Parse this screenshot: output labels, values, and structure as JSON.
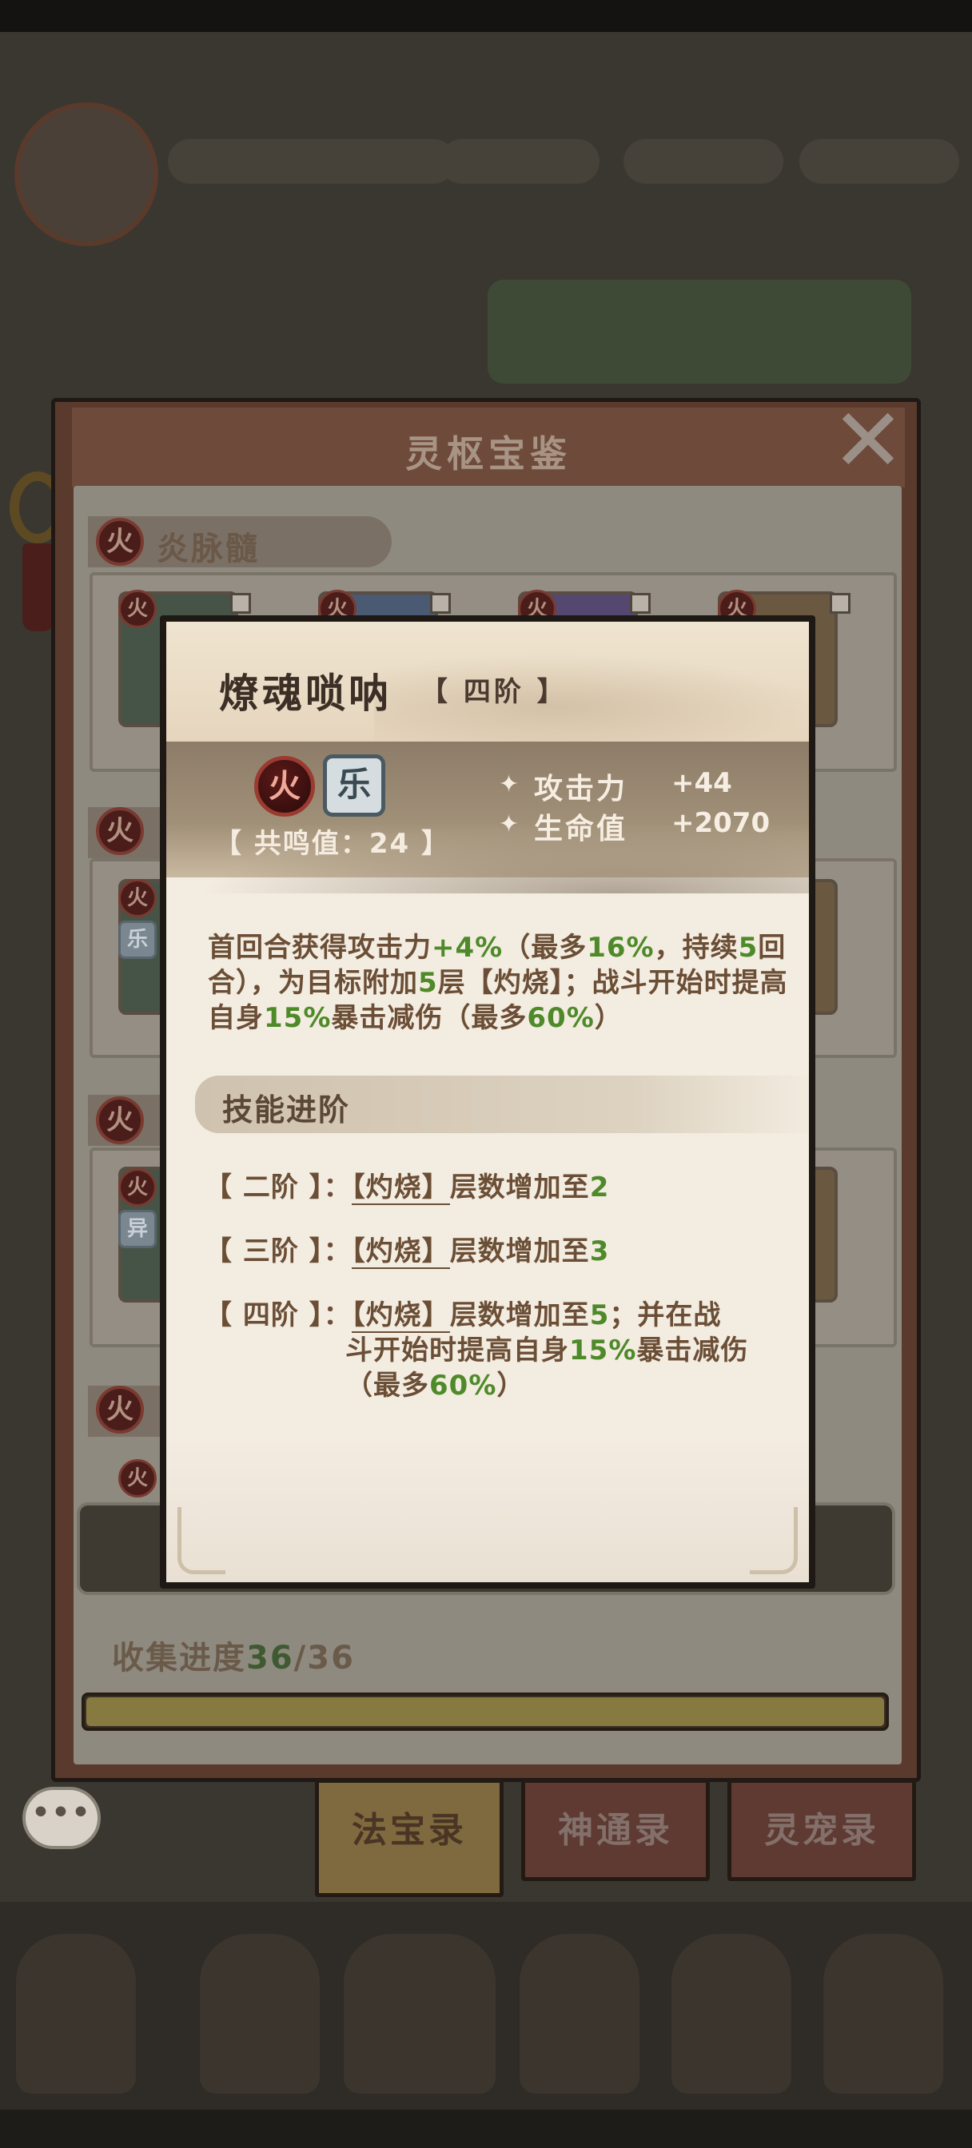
{
  "book": {
    "title": "灵枢宝鉴",
    "close_symbol": "✕",
    "section1": {
      "element": "火",
      "name": "炎脉髓"
    },
    "section_elem": "火",
    "card_tags": [
      "火",
      "乐",
      "异"
    ],
    "progress": {
      "label": "收集进度",
      "current": "36",
      "sep": "/",
      "total": "36",
      "fraction": 1.0
    },
    "chat_symbol": "•••"
  },
  "tabs": [
    {
      "label": "法宝录",
      "active": true
    },
    {
      "label": "神通录",
      "active": false
    },
    {
      "label": "灵宠录",
      "active": false
    }
  ],
  "popup": {
    "item_name": "燎魂唢呐",
    "tier": "【 四阶 】",
    "element_fire": "火",
    "element_music": "乐",
    "resonance": "【 共鸣值：24 】",
    "stats": [
      {
        "name": "攻击力",
        "value": "+44"
      },
      {
        "name": "生命值",
        "value": "+2070"
      }
    ],
    "desc": {
      "p1": "首回合获得攻击力",
      "v1": "+4%",
      "p2": "（最多",
      "v2": "16%",
      "p3": "，持续",
      "v3": "5",
      "p4": "回合），为目标附加",
      "v4": "5",
      "p5": "层【灼烧】；战斗开始时提高自身",
      "v5": "15%",
      "p6": "暴击减伤（最多",
      "v6": "60%",
      "p7": "）"
    },
    "skill_header": "技能进阶",
    "advances": [
      {
        "label": "【 二阶 】：",
        "pre": "",
        "key": "【灼烧】",
        "mid": "层数增加至",
        "val": "2"
      },
      {
        "label": "【 三阶 】：",
        "pre": "",
        "key": "【灼烧】",
        "mid": "层数增加至",
        "val": "3"
      }
    ],
    "advance4": {
      "label": "【 四阶 】：",
      "key": "【灼烧】",
      "t1": "层数增加至",
      "v1": "5",
      "t2": "；并在战",
      "t3": "斗开始时提高自身",
      "v2": "15%",
      "t4": "暴击减伤",
      "t5": "（最多",
      "v3": "60%",
      "t6": "）"
    }
  }
}
